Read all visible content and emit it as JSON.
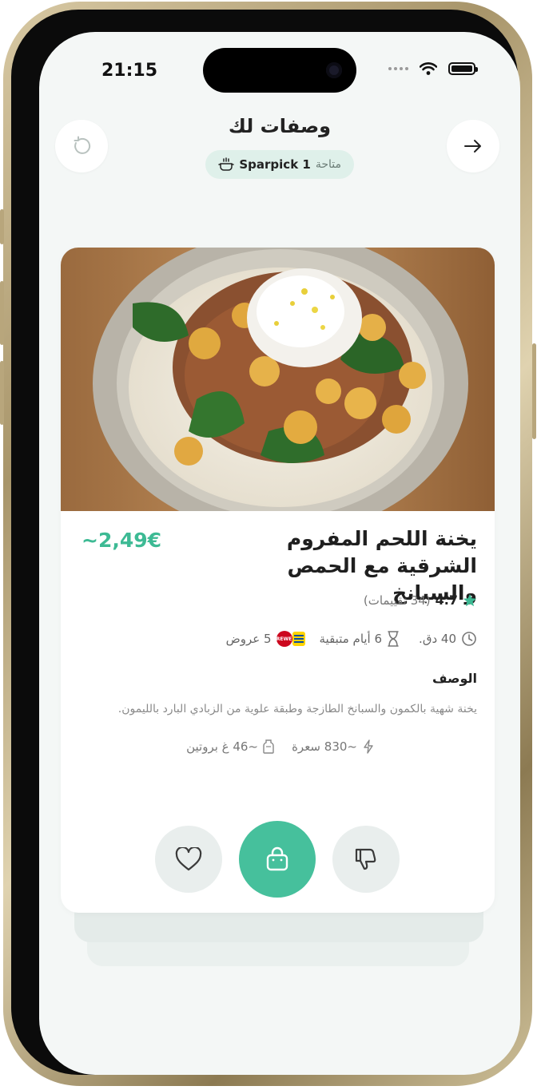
{
  "status_bar": {
    "time": "21:15"
  },
  "header": {
    "title": "وصفات لك",
    "badge": {
      "prefix": "متاحة",
      "value": "1 Sparpick"
    },
    "left_button_icon": "refresh-icon",
    "right_button_icon": "arrow-right-icon"
  },
  "recipe": {
    "price": "~2,49€",
    "title": "يخنة اللحم المفروم الشرقية مع الحمص والسبانخ",
    "rating": "4.7",
    "rating_count": "(34 تقييمات)",
    "meta": {
      "time": "40 دق.",
      "days_left": "6 أيام متبقية",
      "offers": "5 عروض",
      "store_logo_text": "REWE"
    },
    "description_heading": "الوصف",
    "description": "يخنة شهية بالكمون والسبانخ الطازجة وطبقة علوية من الزبادي البارد بالليمون.",
    "calories": "~830 سعرة",
    "protein": "~46 غ بروتين"
  },
  "actions": {
    "like_icon": "heart-icon",
    "cart_icon": "shopping-bag-icon",
    "dislike_icon": "thumbs-down-icon"
  },
  "colors": {
    "accent": "#46c09c",
    "price": "#3dba94",
    "badge_bg": "#dff0ea",
    "screen_bg": "#f4f7f6",
    "star": "#3dba94"
  }
}
